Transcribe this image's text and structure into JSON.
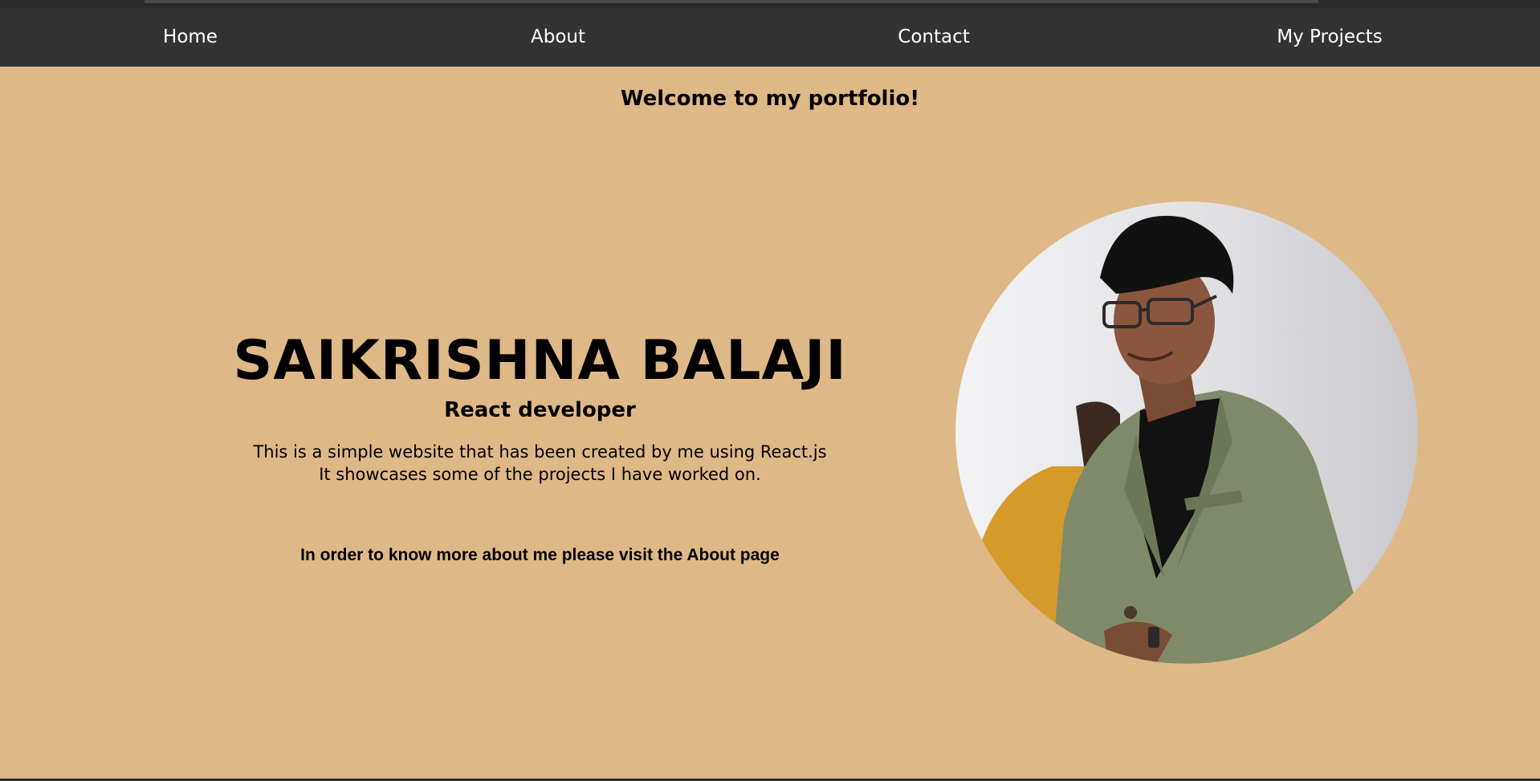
{
  "nav": {
    "items": [
      {
        "label": "Home"
      },
      {
        "label": "About"
      },
      {
        "label": "Contact"
      },
      {
        "label": "My Projects"
      }
    ]
  },
  "welcome": "Welcome to my portfolio!",
  "hero": {
    "name": "SAIKRISHNA BALAJI",
    "role": "React developer",
    "description_lines": [
      "This is a simple website that has been created by me using React.js",
      "It showcases some of the projects I have worked on."
    ],
    "more_info": "In order to know more about me please visit the About page"
  },
  "colors": {
    "background": "#dfb887",
    "navbar": "#333333",
    "nav_text": "#ffffff",
    "text": "#000000"
  }
}
